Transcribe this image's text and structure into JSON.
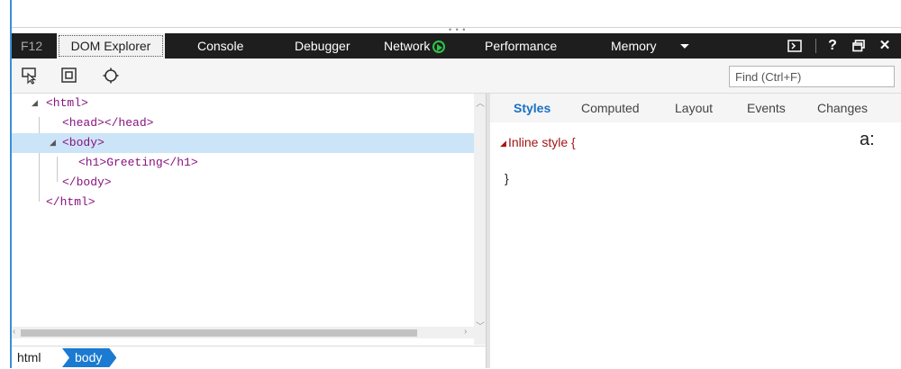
{
  "tabs": {
    "f12": "F12",
    "dom_explorer": "DOM Explorer",
    "console": "Console",
    "debugger": "Debugger",
    "network": "Network",
    "performance": "Performance",
    "memory": "Memory"
  },
  "window_controls": {
    "more": "⏷",
    "help": "?",
    "close": "✕"
  },
  "toolbar": {
    "find_placeholder": "Find (Ctrl+F)"
  },
  "dom_tree": {
    "line1": "<html>",
    "line2": "<head></head>",
    "line3": "<body>",
    "line4": "<h1>Greeting</h1>",
    "line5": "</body>",
    "line6": "</html>"
  },
  "breadcrumb": [
    "html",
    "body"
  ],
  "styles_tabs": [
    "Styles",
    "Computed",
    "Layout",
    "Events",
    "Changes"
  ],
  "styles": {
    "inline_style": "Inline style  {",
    "closing_brace": "}",
    "state_toggle": "a:"
  },
  "colors": {
    "tab_bar": "#1e1e1e",
    "selection": "#cce4f7",
    "tag": "#881280",
    "accent": "#1b7ad1",
    "network_green": "#2ec44b"
  }
}
